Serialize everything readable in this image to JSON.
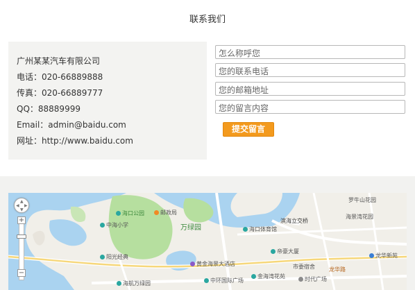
{
  "page": {
    "title": "联系我们"
  },
  "contact": {
    "company": "广州某某汽车有限公司",
    "phone": "电话：020-66889888",
    "fax": "传真：020-66889777",
    "qq": "QQ：88889999",
    "email": "Email：admin@baidu.com",
    "website": "网址：http://www.baidu.com"
  },
  "form": {
    "name_placeholder": "怎么称呼您",
    "phone_placeholder": "您的联系电话",
    "email_placeholder": "您的邮箱地址",
    "message_placeholder": "您的留言内容",
    "submit_label": "提交留言"
  },
  "map": {
    "controls": {
      "zoom_in": "+",
      "zoom_out": "−"
    },
    "labels": {
      "haikou_park": "海口公园",
      "zhonghai_school": "中海小学",
      "post_office": "邮政局",
      "wanlv_park": "万绿园",
      "sports_center": "海口体育馆",
      "binhai_bridge": "滨海立交桥",
      "luoniushan": "罗牛山花园",
      "hainan_garden": "海景湾花园",
      "sunshine": "阳光经典",
      "jinmao": "黄金海景大酒店",
      "haihang": "海航万绿园",
      "jinmao_plaza": "中环国际广场",
      "wanhao": "金海湾花苑",
      "dehua": "帝豪大厦",
      "shiqu": "市委宿舍",
      "shidai": "时代广场",
      "longhua": "龙华路",
      "dongfeng": "龙华新苑"
    }
  },
  "colors": {
    "accent": "#f39a1e",
    "water": "#aad3f0",
    "park": "#b6df9f"
  }
}
